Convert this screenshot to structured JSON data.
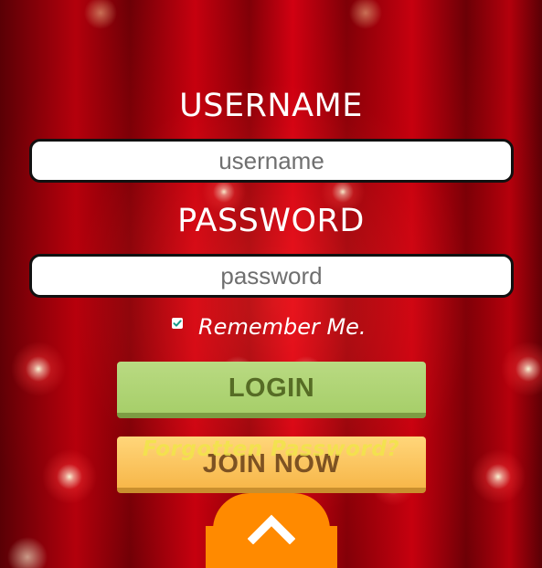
{
  "form": {
    "username_label": "USERNAME",
    "username_placeholder": "username",
    "password_label": "PASSWORD",
    "password_placeholder": "password",
    "remember_label": "Remember Me.",
    "remember_checked": true,
    "login_label": "LOGIN",
    "join_label": "JOIN NOW",
    "forgot_label": "Forgotten Password?"
  },
  "icons": {
    "checkbox": "checkmark-icon",
    "scroll_top": "chevron-up-icon"
  },
  "colors": {
    "background": "#b3000c",
    "login_button": "#a7cf6a",
    "login_text": "#566c25",
    "join_button": "#f7b74a",
    "join_text": "#7d5222",
    "forgot_text": "#f2e54a",
    "scroll_top_button": "#ff8a00"
  }
}
